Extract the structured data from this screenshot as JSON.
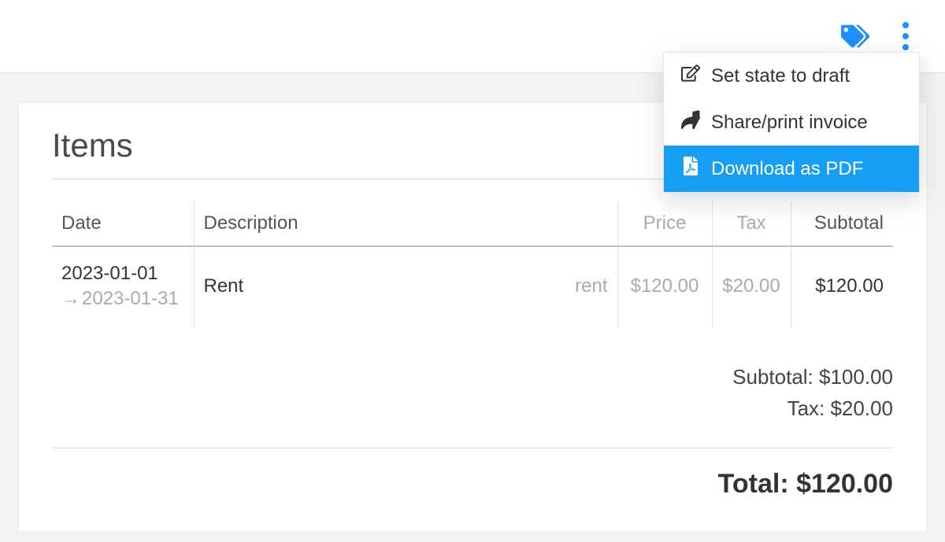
{
  "toolbar": {
    "menu": {
      "draft_label": "Set state to draft",
      "share_label": "Share/print invoice",
      "download_label": "Download as PDF"
    }
  },
  "section_title": "Items",
  "columns": {
    "date": "Date",
    "description": "Description",
    "price": "Price",
    "tax": "Tax",
    "subtotal": "Subtotal"
  },
  "rows": [
    {
      "date_from": "2023-01-01",
      "date_to": "2023-01-31",
      "description": "Rent",
      "tag": "rent",
      "price": "$120.00",
      "tax": "$20.00",
      "subtotal": "$120.00"
    }
  ],
  "summary": {
    "subtotal_label": "Subtotal: $100.00",
    "tax_label": "Tax: $20.00",
    "total_label": "Total: $120.00"
  }
}
